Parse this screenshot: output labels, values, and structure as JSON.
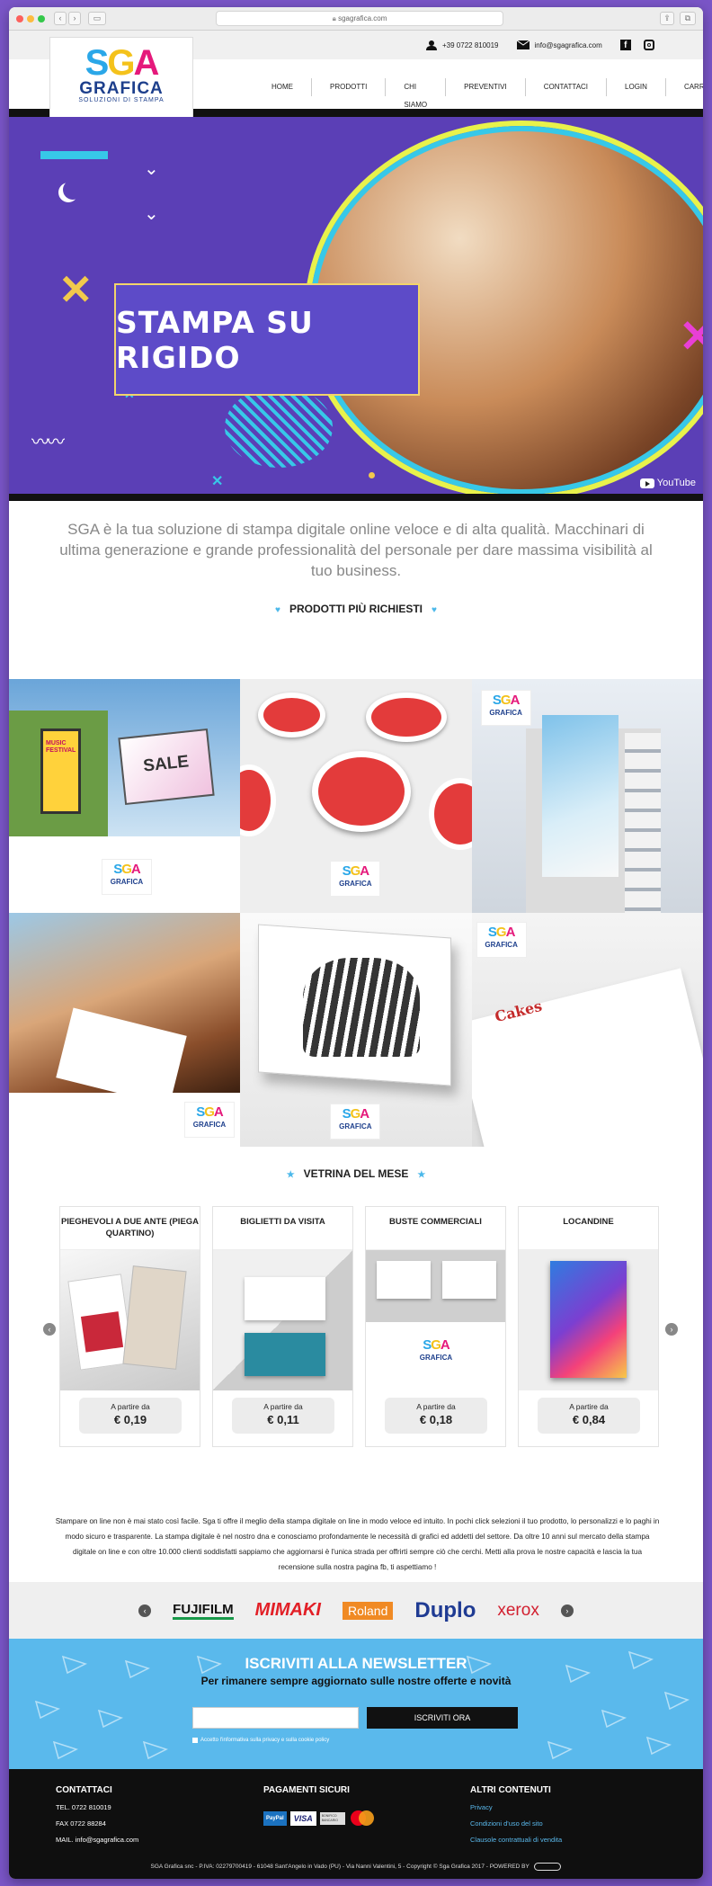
{
  "browser": {
    "url": "sgagrafica.com"
  },
  "topbar": {
    "phone": "+39 0722 810019",
    "email": "info@sgagrafica.com"
  },
  "logo": {
    "brand": "SGA",
    "name": "GRAFICA",
    "tagline": "SOLUZIONI DI STAMPA"
  },
  "nav": [
    "HOME",
    "PRODOTTI",
    "CHI SIAMO",
    "PREVENTIVI",
    "CONTATTACI",
    "LOGIN",
    "CARRELLO"
  ],
  "hero": {
    "title": "STAMPA SU RIGIDO",
    "video_brand": "YouTube"
  },
  "intro": "SGA è la tua soluzione di stampa digitale online veloce e di alta qualità. Macchinari di ultima generazione e grande professionalità del personale per dare massima visibilità al tuo business.",
  "products_title": "PRODOTTI PIÙ RICHIESTI",
  "product_images": {
    "billboard_text": "SALE",
    "poster_text": "MUSIC FESTIVAL",
    "cake_brand": "Cakes"
  },
  "showcase_title": "VETRINA DEL MESE",
  "showcase": [
    {
      "name": "PIEGHEVOLI A DUE ANTE (PIEGA QUARTINO)",
      "from": "A partire da",
      "price": "€ 0,19"
    },
    {
      "name": "BIGLIETTI DA VISITA",
      "from": "A partire da",
      "price": "€ 0,11"
    },
    {
      "name": "BUSTE COMMERCIALI",
      "from": "A partire da",
      "price": "€ 0,18"
    },
    {
      "name": "LOCANDINE",
      "from": "A partire da",
      "price": "€ 0,84"
    }
  ],
  "paragraph": "Stampare on line non è mai stato così facile. Sga ti offre il meglio della stampa digitale on line in modo veloce ed intuito. In pochi click selezioni il tuo prodotto, lo personalizzi e lo paghi in modo sicuro e trasparente. La stampa digitale è nel nostro dna e conosciamo profondamente le necessità di grafici ed addetti del settore. Da oltre 10 anni sul mercato della stampa digitale on line e con oltre 10.000 clienti soddisfatti sappiamo che aggiornarsi è l'unica strada per offrirti sempre ciò che cerchi. Metti alla prova le nostre capacità e lascia la tua recensione sulla nostra pagina fb, ti aspettiamo !",
  "partners": [
    "FUJIFILM",
    "MIMAKI",
    "Roland",
    "Duplo",
    "xerox"
  ],
  "newsletter": {
    "title": "ISCRIVITI ALLA NEWSLETTER",
    "subtitle": "Per rimanere sempre aggiornato sulle nostre offerte e novità",
    "email_value": "",
    "button": "ISCRIVITI ORA",
    "consent": "Accetto l'informativa sulla privacy e sulla cookie policy"
  },
  "footer": {
    "contact_title": "CONTATTACI",
    "tel": "TEL. 0722 810019",
    "fax": "FAX 0722 88284",
    "mail": "MAIL. info@sgagrafica.com",
    "payments_title": "PAGAMENTI SICURI",
    "payments": [
      "PayPal",
      "VISA",
      "BONIFICO BANCARIO",
      "mastercard"
    ],
    "other_title": "ALTRI CONTENUTI",
    "links": [
      "Privacy",
      "Condizioni d'uso del sito",
      "Clausole contrattuali di vendita"
    ],
    "legal": "SGA Grafica snc - P.IVA: 02279700419 - 61048 Sant'Angelo in Vado (PU) - Via Nanni Valentini, 5 - Copyright © Sga Grafica 2017 - POWERED BY"
  },
  "colors": {
    "accent": "#5ab9ec",
    "hero_bg": "#5b3fb6",
    "footer_bg": "#0f0f0f"
  }
}
